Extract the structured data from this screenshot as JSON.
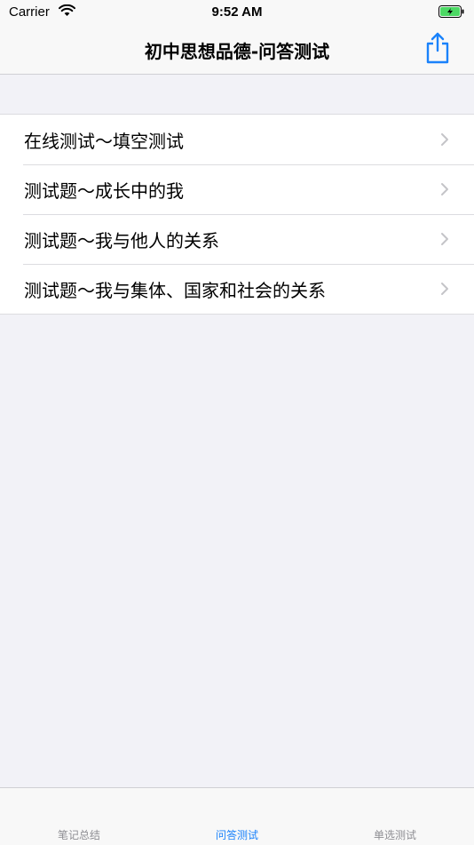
{
  "status": {
    "carrier": "Carrier",
    "time": "9:52 AM"
  },
  "nav": {
    "title": "初中思想品德-问答测试"
  },
  "rows": [
    {
      "label": "在线测试～填空测试"
    },
    {
      "label": "测试题～成长中的我"
    },
    {
      "label": "测试题～我与他人的关系"
    },
    {
      "label": "测试题～我与集体、国家和社会的关系"
    }
  ],
  "tabs": [
    {
      "label": "笔记总结"
    },
    {
      "label": "问答测试"
    },
    {
      "label": "单选测试"
    }
  ],
  "colors": {
    "accent": "#1a82fb",
    "battery": "#4cd964"
  },
  "icons": [
    "wifi-icon",
    "battery-icon",
    "share-icon",
    "chevron-right-icon"
  ]
}
